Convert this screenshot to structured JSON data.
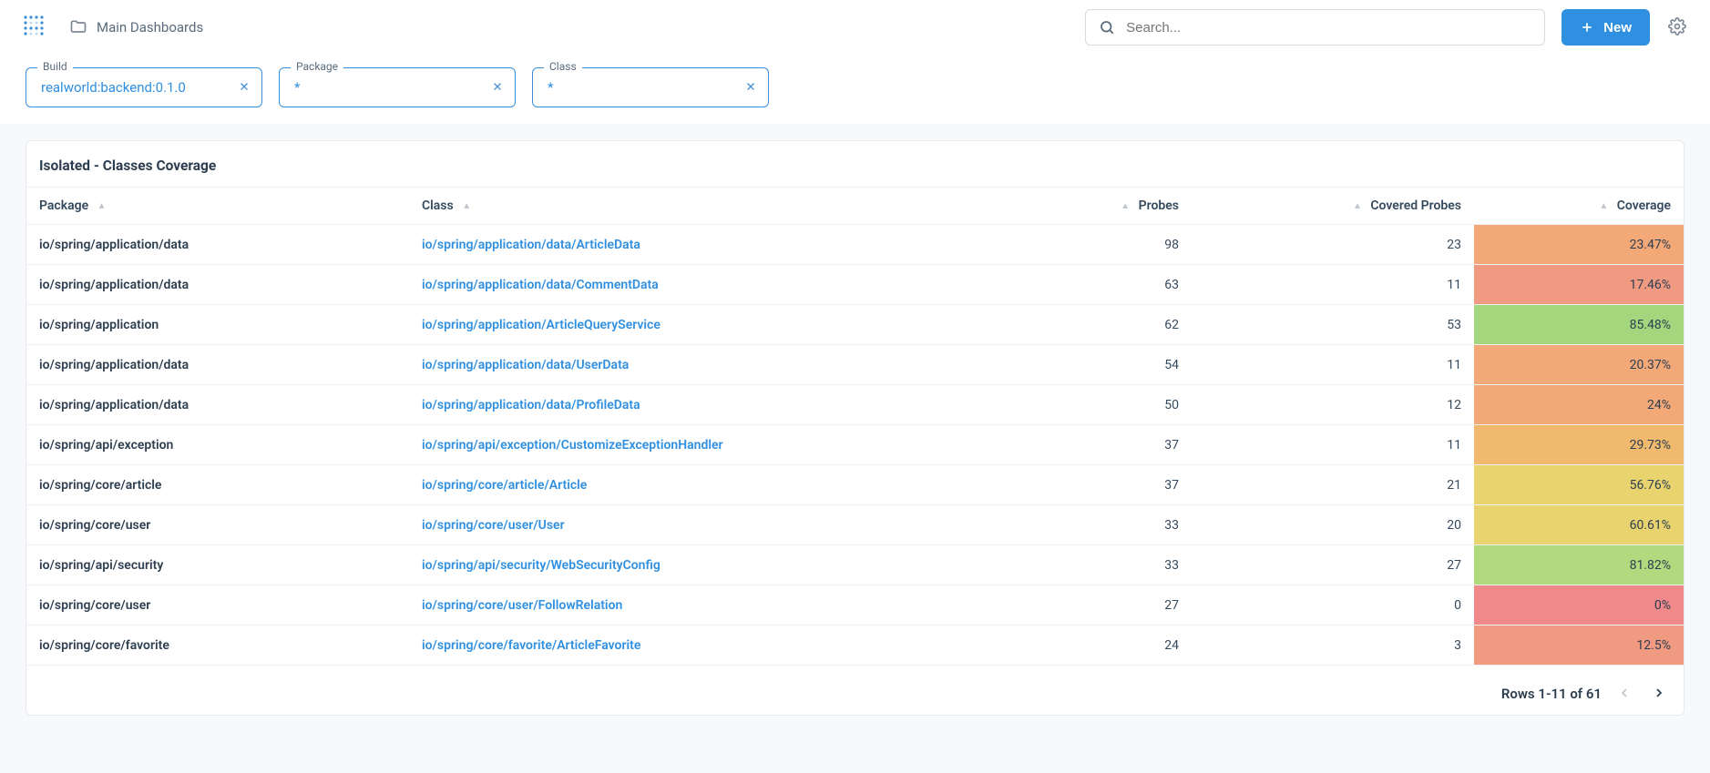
{
  "header": {
    "breadcrumb": "Main Dashboards",
    "search_placeholder": "Search...",
    "new_label": "New"
  },
  "filters": [
    {
      "legend": "Build",
      "value": "realworld:backend:0.1.0"
    },
    {
      "legend": "Package",
      "value": "*"
    },
    {
      "legend": "Class",
      "value": "*"
    }
  ],
  "panel": {
    "title": "Isolated - Classes Coverage",
    "columns": {
      "package": "Package",
      "class": "Class",
      "probes": "Probes",
      "covered": "Covered Probes",
      "coverage": "Coverage"
    },
    "rows": [
      {
        "pkg": "io/spring/application/data",
        "cls": "io/spring/application/data/ArticleData",
        "probes": "98",
        "covered": "23",
        "coverage": "23.47%",
        "level": "lvl-2"
      },
      {
        "pkg": "io/spring/application/data",
        "cls": "io/spring/application/data/CommentData",
        "probes": "63",
        "covered": "11",
        "coverage": "17.46%",
        "level": "lvl-1"
      },
      {
        "pkg": "io/spring/application",
        "cls": "io/spring/application/ArticleQueryService",
        "probes": "62",
        "covered": "53",
        "coverage": "85.48%",
        "level": "lvl-7"
      },
      {
        "pkg": "io/spring/application/data",
        "cls": "io/spring/application/data/UserData",
        "probes": "54",
        "covered": "11",
        "coverage": "20.37%",
        "level": "lvl-2"
      },
      {
        "pkg": "io/spring/application/data",
        "cls": "io/spring/application/data/ProfileData",
        "probes": "50",
        "covered": "12",
        "coverage": "24%",
        "level": "lvl-2"
      },
      {
        "pkg": "io/spring/api/exception",
        "cls": "io/spring/api/exception/CustomizeExceptionHandler",
        "probes": "37",
        "covered": "11",
        "coverage": "29.73%",
        "level": "lvl-3"
      },
      {
        "pkg": "io/spring/core/article",
        "cls": "io/spring/core/article/Article",
        "probes": "37",
        "covered": "21",
        "coverage": "56.76%",
        "level": "lvl-4"
      },
      {
        "pkg": "io/spring/core/user",
        "cls": "io/spring/core/user/User",
        "probes": "33",
        "covered": "20",
        "coverage": "60.61%",
        "level": "lvl-4"
      },
      {
        "pkg": "io/spring/api/security",
        "cls": "io/spring/api/security/WebSecurityConfig",
        "probes": "33",
        "covered": "27",
        "coverage": "81.82%",
        "level": "lvl-6"
      },
      {
        "pkg": "io/spring/core/user",
        "cls": "io/spring/core/user/FollowRelation",
        "probes": "27",
        "covered": "0",
        "coverage": "0%",
        "level": "lvl-0"
      },
      {
        "pkg": "io/spring/core/favorite",
        "cls": "io/spring/core/favorite/ArticleFavorite",
        "probes": "24",
        "covered": "3",
        "coverage": "12.5%",
        "level": "lvl-1"
      }
    ]
  },
  "footer": {
    "rows_label": "Rows 1-11 of 61"
  }
}
